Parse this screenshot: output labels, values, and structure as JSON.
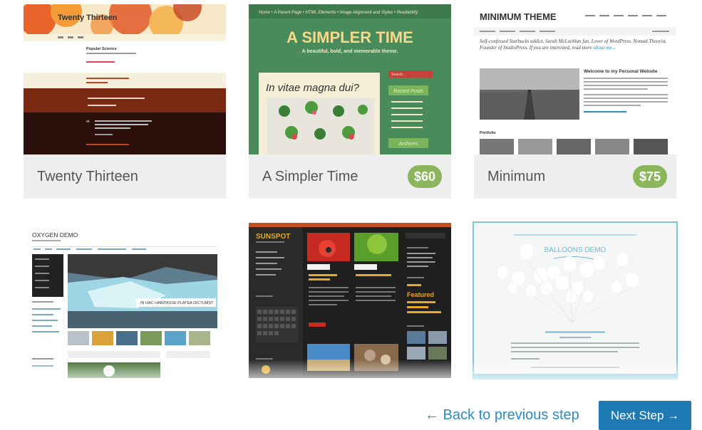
{
  "themes": [
    {
      "name": "Twenty Thirteen",
      "price": "",
      "preview": {
        "site_title": "Twenty Thirteen",
        "post_title": "Popular Science",
        "quote_text": "I remember when the universe is a machine designed for the perpetual astonishment of astronomers."
      }
    },
    {
      "name": "A Simpler Time",
      "price": "$60",
      "preview": {
        "nav": "Home  •  A Parent Page  •  HTML Elements  •  Image Alignment and Styles  •  Readability",
        "site_title": "A SIMPLER TIME",
        "tagline": "A beautiful, bold, and memorable theme.",
        "search_label": "Search...",
        "post_heading": "In vitae magna dui?",
        "widget_1": "Recent Posts",
        "widget_2": "Archives"
      }
    },
    {
      "name": "Minimum",
      "price": "$75",
      "preview": {
        "site_title": "MINIMUM THEME",
        "intro": "Self-confessed Starbucks addict. Sarah McLachlan fan. Lover of WordPress. Nomad Theorist. Founder of StudioPress. If you are interested, read more",
        "intro_link": "about me...",
        "welcome": "Welcome to my Personal Website",
        "portfolio": "Portfolio"
      }
    },
    {
      "name": "Oxygen Demo",
      "preview": {
        "site_title": "OXYGEN DEMO",
        "feature_caption": "IN HAC HABITASSE PLATEA DICTUMST"
      }
    },
    {
      "name": "Sunspot",
      "preview": {
        "site_title": "SUNSPOT",
        "featured": "Featured"
      }
    },
    {
      "name": "Balloons Demo",
      "preview": {
        "site_title": "BALLOONS DEMO"
      }
    }
  ],
  "nav": {
    "back_label": "← Back to previous step",
    "next_label": "Next Step →"
  },
  "colors": {
    "price_badge": "#8bb65c",
    "primary_button": "#1e7ab3",
    "link": "#2d8cc1",
    "selected_border": "#7fc3de"
  }
}
